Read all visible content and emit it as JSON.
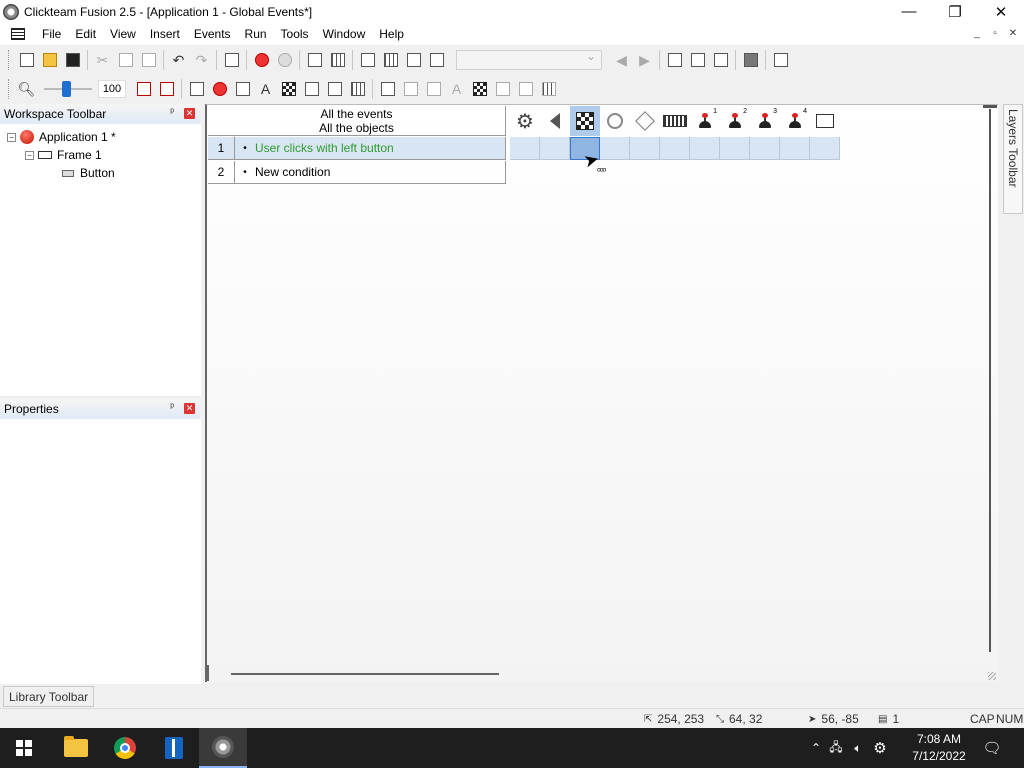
{
  "window": {
    "title": "Clickteam Fusion 2.5 - [Application 1 - Global Events*]",
    "controls": [
      "—",
      "❐",
      "✕"
    ]
  },
  "menubar": {
    "items": [
      "File",
      "Edit",
      "View",
      "Insert",
      "Events",
      "Run",
      "Tools",
      "Window",
      "Help"
    ],
    "mdi_controls": [
      "_",
      "▫",
      "✕"
    ]
  },
  "toolbar": {
    "zoom_value": "100"
  },
  "workspace": {
    "title": "Workspace Toolbar",
    "pin": "ᵖ",
    "close": "✕",
    "tree": [
      {
        "label": "Application 1 *",
        "icon": "application-icon",
        "expander": "−"
      },
      {
        "label": "Frame 1",
        "icon": "frame-icon",
        "expander": "−"
      },
      {
        "label": "Button",
        "icon": "button-object-icon"
      }
    ]
  },
  "properties": {
    "title": "Properties",
    "pin": "ᵖ",
    "close": "✕"
  },
  "library": {
    "tab_label": "Library Toolbar"
  },
  "layers": {
    "tab_label": "Layers Toolbar"
  },
  "event_editor": {
    "header_line1": "All the events",
    "header_line2": "All the objects",
    "events": [
      {
        "number": "1",
        "bullet": "•",
        "condition": "User clicks with left button",
        "color": "#2f9a2f"
      },
      {
        "number": "2",
        "bullet": "•",
        "condition": "New condition",
        "color": "#000000"
      }
    ],
    "object_columns": [
      {
        "name": "special-conditions",
        "icon": "gear-icon"
      },
      {
        "name": "sound",
        "icon": "speaker-icon"
      },
      {
        "name": "storyboard-controls",
        "icon": "checkerboard-icon",
        "selected": true
      },
      {
        "name": "timer",
        "icon": "stopwatch-icon"
      },
      {
        "name": "create-new-objects",
        "icon": "cube-icon"
      },
      {
        "name": "mouse-keyboard",
        "icon": "keyboard-icon"
      },
      {
        "name": "player-1",
        "icon": "joystick-icon",
        "label": "1"
      },
      {
        "name": "player-2",
        "icon": "joystick-icon",
        "label": "2"
      },
      {
        "name": "player-3",
        "icon": "joystick-icon",
        "label": "3"
      },
      {
        "name": "player-4",
        "icon": "joystick-icon",
        "label": "4"
      },
      {
        "name": "button",
        "icon": "button-object-icon"
      }
    ],
    "cursor_dots": "ₒₒₒ"
  },
  "statusbar": {
    "position": "254, 253",
    "size": "64, 32",
    "mouse": "56, -85",
    "layer": "1",
    "caps": "CAP",
    "num": "NUM"
  },
  "taskbar": {
    "time": "7:08 AM",
    "date": "7/12/2022",
    "tray_icons": [
      "chevron-up-icon",
      "network-icon",
      "volume-icon",
      "settings-icon"
    ],
    "notification_icon": "notification-icon"
  }
}
